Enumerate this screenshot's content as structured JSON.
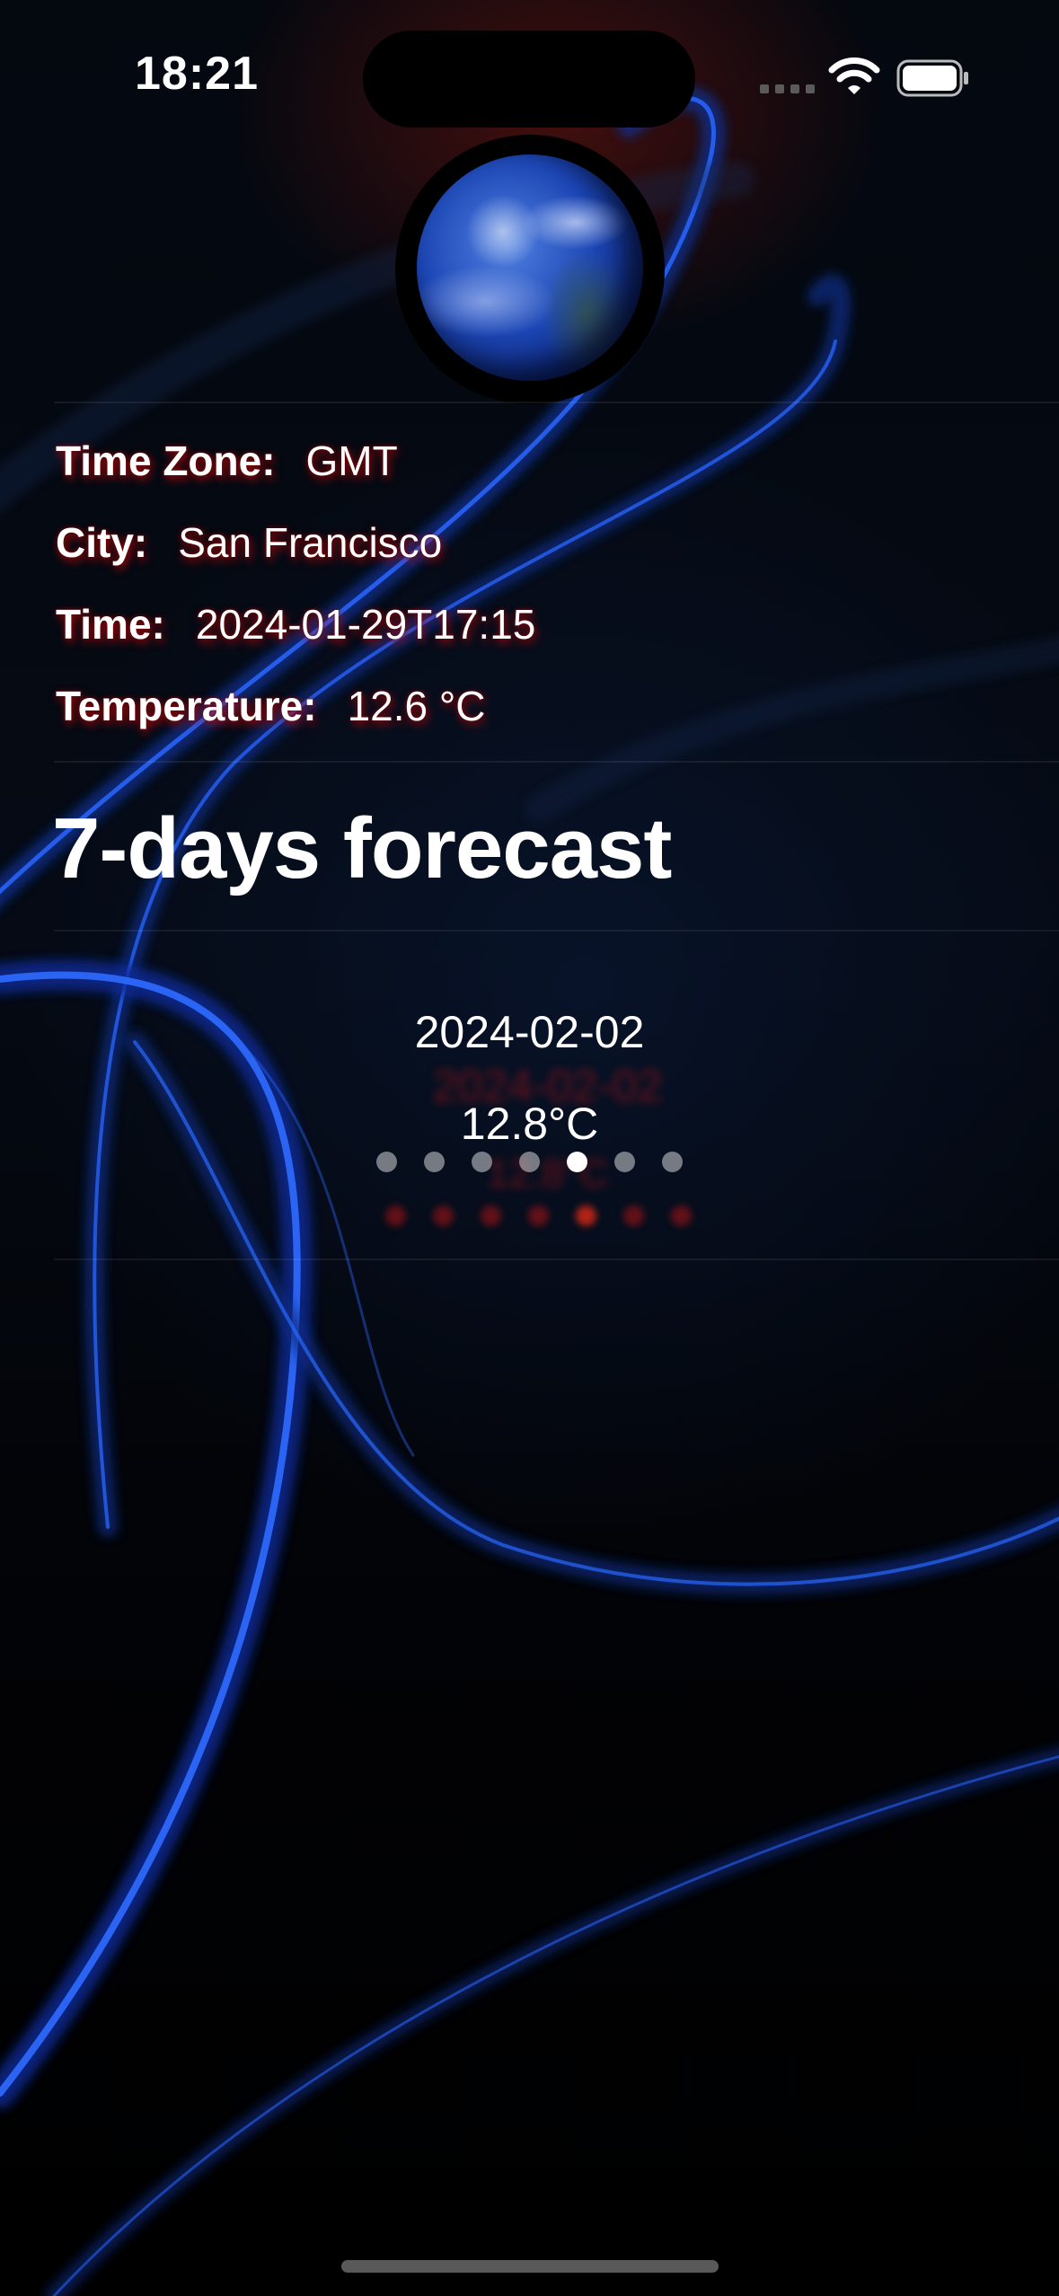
{
  "status_bar": {
    "time": "18:21",
    "icons": [
      "cellular-signal-icon",
      "wifi-icon",
      "battery-icon"
    ]
  },
  "header": {
    "globe_image": "earth-globe-icon"
  },
  "info": {
    "time_zone_label": "Time Zone:",
    "time_zone_value": "GMT",
    "city_label": "City:",
    "city_value": "San Francisco",
    "time_label": "Time:",
    "time_value": "2024-01-29T17:15",
    "temperature_label": "Temperature:",
    "temperature_value": "12.6 °C"
  },
  "forecast": {
    "title": "7-days forecast",
    "current_card": {
      "date": "2024-02-02",
      "temperature": "12.8°C"
    },
    "page_count": 7,
    "active_page_index": 4
  },
  "colors": {
    "background": "#000000",
    "text": "#ffffff",
    "shadow_accent": "#c81414",
    "swirl_blue": "#1e5bff"
  }
}
